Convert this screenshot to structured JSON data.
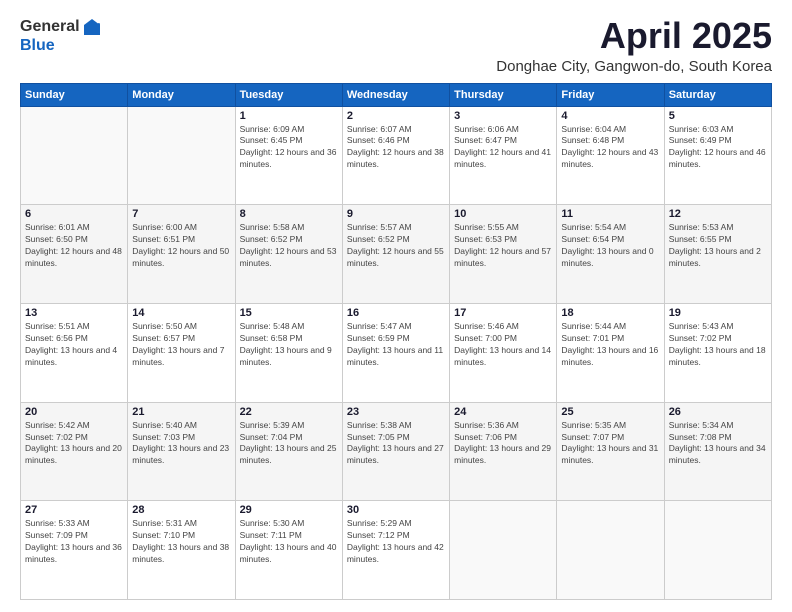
{
  "header": {
    "logo_general": "General",
    "logo_blue": "Blue",
    "title": "April 2025",
    "subtitle": "Donghae City, Gangwon-do, South Korea"
  },
  "days_of_week": [
    "Sunday",
    "Monday",
    "Tuesday",
    "Wednesday",
    "Thursday",
    "Friday",
    "Saturday"
  ],
  "weeks": [
    [
      {
        "day": "",
        "sunrise": "",
        "sunset": "",
        "daylight": ""
      },
      {
        "day": "",
        "sunrise": "",
        "sunset": "",
        "daylight": ""
      },
      {
        "day": "1",
        "sunrise": "Sunrise: 6:09 AM",
        "sunset": "Sunset: 6:45 PM",
        "daylight": "Daylight: 12 hours and 36 minutes."
      },
      {
        "day": "2",
        "sunrise": "Sunrise: 6:07 AM",
        "sunset": "Sunset: 6:46 PM",
        "daylight": "Daylight: 12 hours and 38 minutes."
      },
      {
        "day": "3",
        "sunrise": "Sunrise: 6:06 AM",
        "sunset": "Sunset: 6:47 PM",
        "daylight": "Daylight: 12 hours and 41 minutes."
      },
      {
        "day": "4",
        "sunrise": "Sunrise: 6:04 AM",
        "sunset": "Sunset: 6:48 PM",
        "daylight": "Daylight: 12 hours and 43 minutes."
      },
      {
        "day": "5",
        "sunrise": "Sunrise: 6:03 AM",
        "sunset": "Sunset: 6:49 PM",
        "daylight": "Daylight: 12 hours and 46 minutes."
      }
    ],
    [
      {
        "day": "6",
        "sunrise": "Sunrise: 6:01 AM",
        "sunset": "Sunset: 6:50 PM",
        "daylight": "Daylight: 12 hours and 48 minutes."
      },
      {
        "day": "7",
        "sunrise": "Sunrise: 6:00 AM",
        "sunset": "Sunset: 6:51 PM",
        "daylight": "Daylight: 12 hours and 50 minutes."
      },
      {
        "day": "8",
        "sunrise": "Sunrise: 5:58 AM",
        "sunset": "Sunset: 6:52 PM",
        "daylight": "Daylight: 12 hours and 53 minutes."
      },
      {
        "day": "9",
        "sunrise": "Sunrise: 5:57 AM",
        "sunset": "Sunset: 6:52 PM",
        "daylight": "Daylight: 12 hours and 55 minutes."
      },
      {
        "day": "10",
        "sunrise": "Sunrise: 5:55 AM",
        "sunset": "Sunset: 6:53 PM",
        "daylight": "Daylight: 12 hours and 57 minutes."
      },
      {
        "day": "11",
        "sunrise": "Sunrise: 5:54 AM",
        "sunset": "Sunset: 6:54 PM",
        "daylight": "Daylight: 13 hours and 0 minutes."
      },
      {
        "day": "12",
        "sunrise": "Sunrise: 5:53 AM",
        "sunset": "Sunset: 6:55 PM",
        "daylight": "Daylight: 13 hours and 2 minutes."
      }
    ],
    [
      {
        "day": "13",
        "sunrise": "Sunrise: 5:51 AM",
        "sunset": "Sunset: 6:56 PM",
        "daylight": "Daylight: 13 hours and 4 minutes."
      },
      {
        "day": "14",
        "sunrise": "Sunrise: 5:50 AM",
        "sunset": "Sunset: 6:57 PM",
        "daylight": "Daylight: 13 hours and 7 minutes."
      },
      {
        "day": "15",
        "sunrise": "Sunrise: 5:48 AM",
        "sunset": "Sunset: 6:58 PM",
        "daylight": "Daylight: 13 hours and 9 minutes."
      },
      {
        "day": "16",
        "sunrise": "Sunrise: 5:47 AM",
        "sunset": "Sunset: 6:59 PM",
        "daylight": "Daylight: 13 hours and 11 minutes."
      },
      {
        "day": "17",
        "sunrise": "Sunrise: 5:46 AM",
        "sunset": "Sunset: 7:00 PM",
        "daylight": "Daylight: 13 hours and 14 minutes."
      },
      {
        "day": "18",
        "sunrise": "Sunrise: 5:44 AM",
        "sunset": "Sunset: 7:01 PM",
        "daylight": "Daylight: 13 hours and 16 minutes."
      },
      {
        "day": "19",
        "sunrise": "Sunrise: 5:43 AM",
        "sunset": "Sunset: 7:02 PM",
        "daylight": "Daylight: 13 hours and 18 minutes."
      }
    ],
    [
      {
        "day": "20",
        "sunrise": "Sunrise: 5:42 AM",
        "sunset": "Sunset: 7:02 PM",
        "daylight": "Daylight: 13 hours and 20 minutes."
      },
      {
        "day": "21",
        "sunrise": "Sunrise: 5:40 AM",
        "sunset": "Sunset: 7:03 PM",
        "daylight": "Daylight: 13 hours and 23 minutes."
      },
      {
        "day": "22",
        "sunrise": "Sunrise: 5:39 AM",
        "sunset": "Sunset: 7:04 PM",
        "daylight": "Daylight: 13 hours and 25 minutes."
      },
      {
        "day": "23",
        "sunrise": "Sunrise: 5:38 AM",
        "sunset": "Sunset: 7:05 PM",
        "daylight": "Daylight: 13 hours and 27 minutes."
      },
      {
        "day": "24",
        "sunrise": "Sunrise: 5:36 AM",
        "sunset": "Sunset: 7:06 PM",
        "daylight": "Daylight: 13 hours and 29 minutes."
      },
      {
        "day": "25",
        "sunrise": "Sunrise: 5:35 AM",
        "sunset": "Sunset: 7:07 PM",
        "daylight": "Daylight: 13 hours and 31 minutes."
      },
      {
        "day": "26",
        "sunrise": "Sunrise: 5:34 AM",
        "sunset": "Sunset: 7:08 PM",
        "daylight": "Daylight: 13 hours and 34 minutes."
      }
    ],
    [
      {
        "day": "27",
        "sunrise": "Sunrise: 5:33 AM",
        "sunset": "Sunset: 7:09 PM",
        "daylight": "Daylight: 13 hours and 36 minutes."
      },
      {
        "day": "28",
        "sunrise": "Sunrise: 5:31 AM",
        "sunset": "Sunset: 7:10 PM",
        "daylight": "Daylight: 13 hours and 38 minutes."
      },
      {
        "day": "29",
        "sunrise": "Sunrise: 5:30 AM",
        "sunset": "Sunset: 7:11 PM",
        "daylight": "Daylight: 13 hours and 40 minutes."
      },
      {
        "day": "30",
        "sunrise": "Sunrise: 5:29 AM",
        "sunset": "Sunset: 7:12 PM",
        "daylight": "Daylight: 13 hours and 42 minutes."
      },
      {
        "day": "",
        "sunrise": "",
        "sunset": "",
        "daylight": ""
      },
      {
        "day": "",
        "sunrise": "",
        "sunset": "",
        "daylight": ""
      },
      {
        "day": "",
        "sunrise": "",
        "sunset": "",
        "daylight": ""
      }
    ]
  ]
}
